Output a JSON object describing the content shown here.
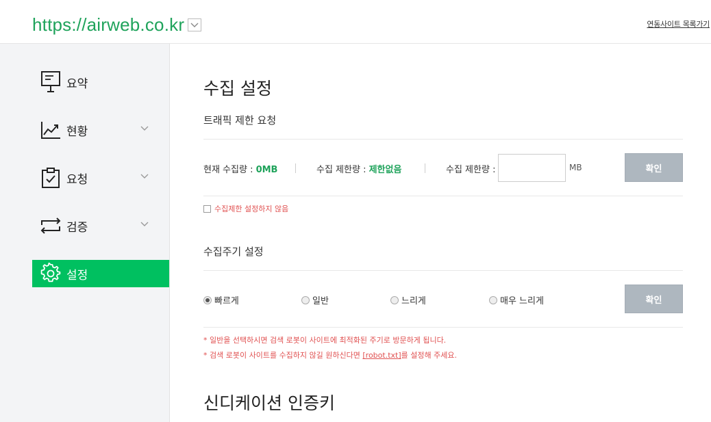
{
  "header": {
    "site_url": "https://airweb.co.kr",
    "site_list_link": "연동사이트 목록가기"
  },
  "sidebar": {
    "items": [
      {
        "label": "요약",
        "icon": "presentation-board-icon",
        "has_chevron": false,
        "active": false
      },
      {
        "label": "현황",
        "icon": "trend-chart-icon",
        "has_chevron": true,
        "active": false
      },
      {
        "label": "요청",
        "icon": "clipboard-check-icon",
        "has_chevron": true,
        "active": false
      },
      {
        "label": "검증",
        "icon": "swap-arrows-icon",
        "has_chevron": true,
        "active": false
      },
      {
        "label": "설정",
        "icon": "gear-icon",
        "has_chevron": false,
        "active": true
      }
    ]
  },
  "colors": {
    "accent": "#00c060",
    "url_green": "#1fa35b",
    "warning": "#e05050",
    "button_gray": "#aeb7bf"
  },
  "main": {
    "title": "수집 설정",
    "traffic": {
      "subtitle": "트래픽 제한 요청",
      "current_label": "현재 수집량 : ",
      "current_value": "0MB",
      "limit_label": "수집 제한량 : ",
      "limit_value": "제한없음",
      "input_label": "수집 제한량 :",
      "input_value": "",
      "unit": "MB",
      "confirm": "확인",
      "no_limit_checkbox": "수집제한 설정하지 않음",
      "no_limit_checked": false
    },
    "cycle": {
      "subtitle": "수집주기 설정",
      "options": [
        "빠르게",
        "일반",
        "느리게",
        "매우 느리게"
      ],
      "selected": "빠르게",
      "confirm": "확인",
      "note1": "* 일반을 선택하시면 검색 로봇이 사이트에 최적화된 주기로 방문하게 됩니다.",
      "note2_prefix": "* 검색 로봇이 사이트를 수집하지 않길 원하신다면 ",
      "note2_link": "[robot.txt]",
      "note2_suffix": "를 설정해 주세요."
    },
    "syndication_title": "신디케이션 인증키"
  }
}
